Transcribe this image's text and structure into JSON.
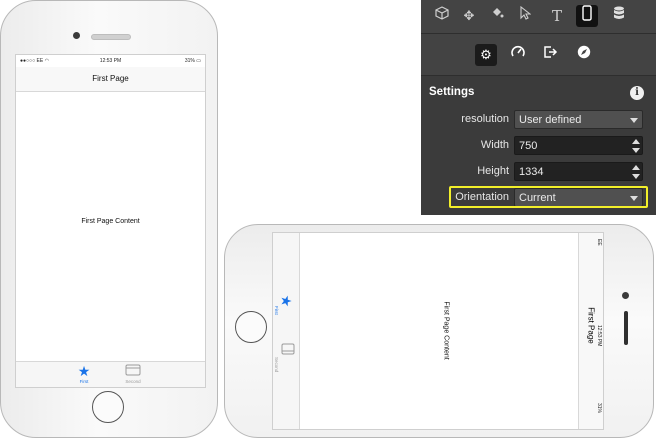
{
  "portrait": {
    "status": {
      "carrier": "EE",
      "time": "12:53 PM",
      "battery": "31%"
    },
    "nav_title": "First Page",
    "content": "First Page Content",
    "tabs": [
      {
        "label": "First",
        "icon": "star-icon",
        "color": "#1a73e8"
      },
      {
        "label": "Second",
        "icon": "square-icon",
        "color": "#9a9a9a"
      }
    ]
  },
  "landscape": {
    "status": {
      "carrier": "EE",
      "time": "12:53 PM",
      "battery": "31%"
    },
    "nav_title": "First Page",
    "content": "First Page Content",
    "tabs": [
      {
        "label": "First",
        "icon": "star-icon",
        "color": "#1a73e8"
      },
      {
        "label": "Second",
        "icon": "square-icon",
        "color": "#9a9a9a"
      }
    ]
  },
  "panel": {
    "toolbar_top": [
      "cube-icon",
      "move-icon",
      "paint-bucket-icon",
      "cursor-icon",
      "text-icon",
      "phone-icon",
      "database-icon"
    ],
    "toolbar_top_active": "phone-icon",
    "toolbar_second": [
      "gear-icon",
      "gauge-icon",
      "export-icon",
      "compass-icon"
    ],
    "toolbar_second_active": "gear-icon",
    "section_title": "Settings",
    "fields": {
      "resolution": {
        "label": "resolution",
        "value": "User defined"
      },
      "width": {
        "label": "Width",
        "value": "750"
      },
      "height": {
        "label": "Height",
        "value": "1334"
      },
      "orientation": {
        "label": "Orientation",
        "value": "Current"
      }
    },
    "highlight_color": "#f2ef2a"
  }
}
